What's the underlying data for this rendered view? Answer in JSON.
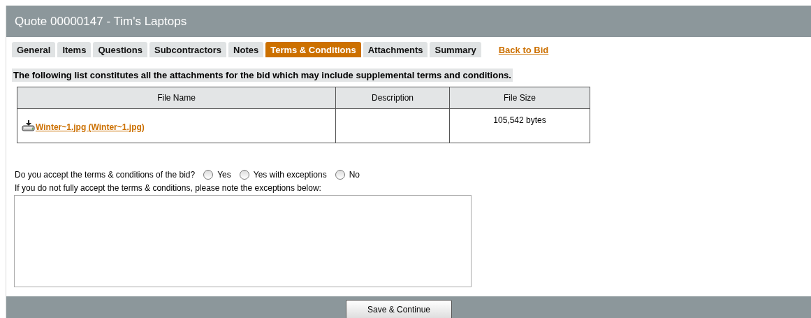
{
  "header": {
    "title": "Quote 00000147 - Tim's Laptops"
  },
  "tabs": [
    {
      "label": "General",
      "selected": false
    },
    {
      "label": "Items",
      "selected": false
    },
    {
      "label": "Questions",
      "selected": false
    },
    {
      "label": "Subcontractors",
      "selected": false
    },
    {
      "label": "Notes",
      "selected": false
    },
    {
      "label": "Terms & Conditions",
      "selected": true
    },
    {
      "label": "Attachments",
      "selected": false
    },
    {
      "label": "Summary",
      "selected": false
    }
  ],
  "back_link": "Back to Bid",
  "notice": "The following list constitutes all the attachments for the bid which may include supplemental terms and conditions.",
  "table": {
    "columns": [
      "File Name",
      "Description",
      "File Size"
    ],
    "rows": [
      {
        "file_name": "Winter~1.jpg (Winter~1.jpg)",
        "file_size": "105,542 bytes"
      }
    ]
  },
  "question": {
    "label": "Do you accept the terms & conditions of the bid?",
    "options": [
      {
        "label": "Yes",
        "selected": false
      },
      {
        "label": "Yes with exceptions",
        "selected": false
      },
      {
        "label": "No",
        "selected": false
      }
    ]
  },
  "exceptions_label": "If you do not fully accept the terms & conditions, please note the exceptions below:",
  "save_button": "Save & Continue"
}
